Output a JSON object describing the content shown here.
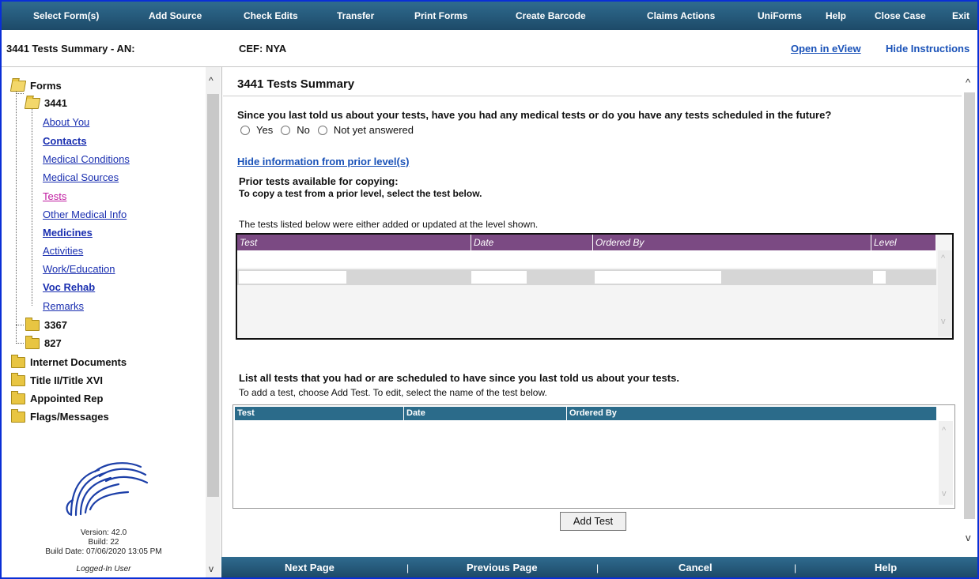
{
  "menu": [
    {
      "label": "Select Form(s)"
    },
    {
      "label": "Add Source"
    },
    {
      "label": "Check Edits"
    },
    {
      "label": "Transfer"
    },
    {
      "label": "Print Forms"
    },
    {
      "label": "Create Barcode"
    },
    {
      "label": "Claims Actions"
    },
    {
      "label": "UniForms"
    },
    {
      "label": "Help"
    },
    {
      "label": "Close Case"
    },
    {
      "label": "Exit"
    }
  ],
  "header": {
    "title": "3441 Tests Summary - AN:",
    "cef": "CEF: NYA",
    "open_eview": "Open in eView",
    "hide_instructions": "Hide Instructions"
  },
  "tree": {
    "forms": "Forms",
    "form_3441": "3441",
    "items": [
      "About You",
      "Contacts",
      "Medical Conditions",
      "Medical Sources",
      "Tests",
      "Other Medical Info",
      "Medicines",
      "Activities",
      "Work/Education",
      "Voc Rehab",
      "Remarks"
    ],
    "form_3367": "3367",
    "form_827": "827",
    "folders": [
      "Internet Documents",
      "Title II/Title XVI",
      "Appointed Rep",
      "Flags/Messages"
    ],
    "version": "Version: 42.0",
    "build": "Build: 22",
    "build_date": "Build Date: 07/06/2020 13:05 PM",
    "user": "Logged-In User"
  },
  "main": {
    "title": "3441 Tests Summary",
    "question": "Since you last told us about your tests, have you had any medical tests or do you have any tests scheduled in the future?",
    "radio_options": [
      "Yes",
      "No",
      "Not yet answered"
    ],
    "hide_prior": "Hide information from prior level(s)",
    "prior_heading": "Prior tests available for copying:",
    "prior_instr": "To copy a test from a prior level, select the test below.",
    "prior_note": "The tests listed below were either added or updated at the level shown.",
    "prior_columns": [
      "Test",
      "Date",
      "Ordered By",
      "Level"
    ],
    "list_heading": "List all tests that you had or are scheduled to have since you last told us about your tests.",
    "list_instr": "To add a test, choose Add Test. To edit, select the name of the test below.",
    "list_columns": [
      "Test",
      "Date",
      "Ordered By"
    ],
    "add_test": "Add Test"
  },
  "bottom": {
    "next": "Next Page",
    "previous": "Previous Page",
    "cancel": "Cancel",
    "help": "Help"
  }
}
